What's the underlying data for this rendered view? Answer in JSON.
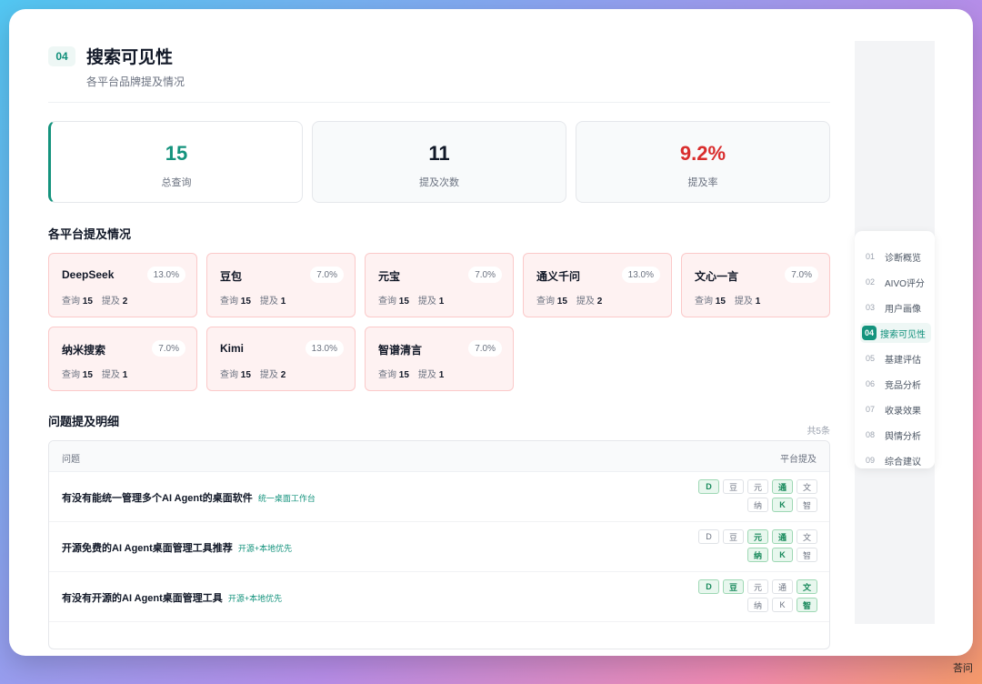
{
  "section": {
    "number": "04",
    "title": "搜索可见性",
    "subtitle": "各平台品牌提及情况"
  },
  "stats": [
    {
      "value": "15",
      "label": "总查询",
      "color": "#14937d"
    },
    {
      "value": "11",
      "label": "提及次数",
      "color": "#111827"
    },
    {
      "value": "9.2%",
      "label": "提及率",
      "color": "#d92d2d"
    }
  ],
  "platforms_heading": "各平台提及情况",
  "query_label": "查询",
  "mention_label": "提及",
  "platforms": [
    {
      "name": "DeepSeek",
      "rate": "13.0%",
      "queries": "15",
      "mentions": "2"
    },
    {
      "name": "豆包",
      "rate": "7.0%",
      "queries": "15",
      "mentions": "1"
    },
    {
      "name": "元宝",
      "rate": "7.0%",
      "queries": "15",
      "mentions": "1"
    },
    {
      "name": "通义千问",
      "rate": "13.0%",
      "queries": "15",
      "mentions": "2"
    },
    {
      "name": "文心一言",
      "rate": "7.0%",
      "queries": "15",
      "mentions": "1"
    },
    {
      "name": "纳米搜索",
      "rate": "7.0%",
      "queries": "15",
      "mentions": "1"
    },
    {
      "name": "Kimi",
      "rate": "13.0%",
      "queries": "15",
      "mentions": "2"
    },
    {
      "name": "智谱清言",
      "rate": "7.0%",
      "queries": "15",
      "mentions": "1"
    }
  ],
  "details": {
    "heading": "问题提及明细",
    "count": "共5条",
    "col_question": "问题",
    "col_platforms": "平台提及",
    "rows": [
      {
        "question": "有没有能统一管理多个AI Agent的桌面软件",
        "tag": "统一桌面工作台",
        "chips": [
          {
            "label": "D",
            "on": true
          },
          {
            "label": "豆",
            "on": false
          },
          {
            "label": "元",
            "on": false
          },
          {
            "label": "通",
            "on": true
          },
          {
            "label": "文",
            "on": false
          },
          {
            "label": "纳",
            "on": false
          },
          {
            "label": "K",
            "on": true
          },
          {
            "label": "智",
            "on": false
          }
        ]
      },
      {
        "question": "开源免费的AI Agent桌面管理工具推荐",
        "tag": "开源+本地优先",
        "chips": [
          {
            "label": "D",
            "on": false
          },
          {
            "label": "豆",
            "on": false
          },
          {
            "label": "元",
            "on": true
          },
          {
            "label": "通",
            "on": true
          },
          {
            "label": "文",
            "on": false
          },
          {
            "label": "纳",
            "on": true
          },
          {
            "label": "K",
            "on": true
          },
          {
            "label": "智",
            "on": false
          }
        ]
      },
      {
        "question": "有没有开源的AI Agent桌面管理工具",
        "tag": "开源+本地优先",
        "chips": [
          {
            "label": "D",
            "on": true
          },
          {
            "label": "豆",
            "on": true
          },
          {
            "label": "元",
            "on": false
          },
          {
            "label": "通",
            "on": false
          },
          {
            "label": "文",
            "on": true
          },
          {
            "label": "纳",
            "on": false
          },
          {
            "label": "K",
            "on": false
          },
          {
            "label": "智",
            "on": true
          }
        ]
      }
    ]
  },
  "nav": [
    {
      "num": "01",
      "label": "诊断概览",
      "active": false
    },
    {
      "num": "02",
      "label": "AIVO评分",
      "active": false
    },
    {
      "num": "03",
      "label": "用户画像",
      "active": false
    },
    {
      "num": "04",
      "label": "搜索可见性",
      "active": true
    },
    {
      "num": "05",
      "label": "基建评估",
      "active": false
    },
    {
      "num": "06",
      "label": "竞品分析",
      "active": false
    },
    {
      "num": "07",
      "label": "收录效果",
      "active": false
    },
    {
      "num": "08",
      "label": "舆情分析",
      "active": false
    },
    {
      "num": "09",
      "label": "综合建议",
      "active": false
    }
  ],
  "watermark": "荅问"
}
